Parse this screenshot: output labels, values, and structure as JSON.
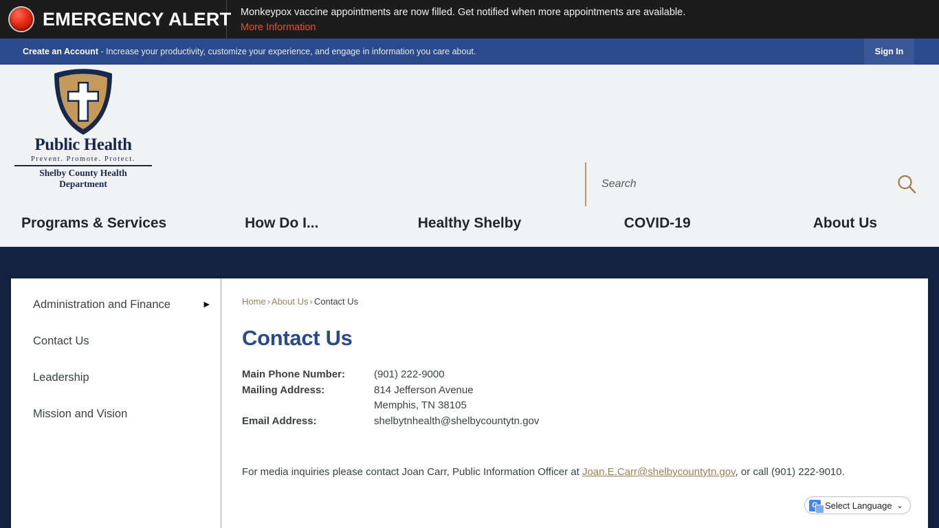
{
  "alert": {
    "icon": "red-alert-light-icon",
    "title": "EMERGENCY ALERT",
    "message": "Monkeypox vaccine appointments are now filled. Get notified when more appointments are available.",
    "link_label": "More Information"
  },
  "account_bar": {
    "create_label": "Create an Account",
    "tagline": " - Increase your productivity, customize your experience, and engage in information you care about.",
    "sign_in_label": "Sign In"
  },
  "logo": {
    "name": "Public Health",
    "tagline": "Prevent. Promote. Protect.",
    "department": "Shelby County Health Department"
  },
  "search": {
    "placeholder": "Search",
    "value": "",
    "icon": "search-icon"
  },
  "nav": {
    "items": [
      {
        "label": "Programs & Services"
      },
      {
        "label": "How Do I..."
      },
      {
        "label": "Healthy Shelby"
      },
      {
        "label": "COVID-19"
      },
      {
        "label": "About Us"
      }
    ]
  },
  "sidebar": {
    "items": [
      {
        "label": "Administration and Finance",
        "has_submenu": true,
        "arrow": "▶"
      },
      {
        "label": "Contact Us",
        "has_submenu": false,
        "arrow": ""
      },
      {
        "label": "Leadership",
        "has_submenu": false,
        "arrow": ""
      },
      {
        "label": "Mission and Vision",
        "has_submenu": false,
        "arrow": ""
      }
    ]
  },
  "breadcrumb": {
    "home": "Home",
    "sep1": "›",
    "about": "About Us",
    "sep2": "›",
    "current": "Contact Us"
  },
  "main": {
    "title": "Contact Us",
    "rows": [
      {
        "label": "Main Phone Number:",
        "value": "(901) 222-9000"
      },
      {
        "label": "Mailing Address:",
        "value": "814 Jefferson Avenue"
      },
      {
        "label": "",
        "value": "Memphis, TN 38105"
      },
      {
        "label": "Email Address:",
        "value": "shelbytnhealth@shelbycountytn.gov"
      }
    ],
    "media_note_before": "For media inquiries please contact Joan Carr, Public Information Officer at ",
    "media_note_email": "Joan.E.Carr@shelbycountytn.gov",
    "media_note_after": ", or call (901) 222-9010."
  },
  "translate": {
    "label": "Select Language",
    "caret": "⌄",
    "icon": "google-translate-icon"
  },
  "colors": {
    "alert_bg": "#1c1c1c",
    "alert_link": "#e4503a",
    "account_bg": "#2b4a8b",
    "header_bg": "#f1f2f4",
    "band_navy": "#13223f",
    "gold": "#b79a6b",
    "title_blue": "#2b4a8b"
  }
}
